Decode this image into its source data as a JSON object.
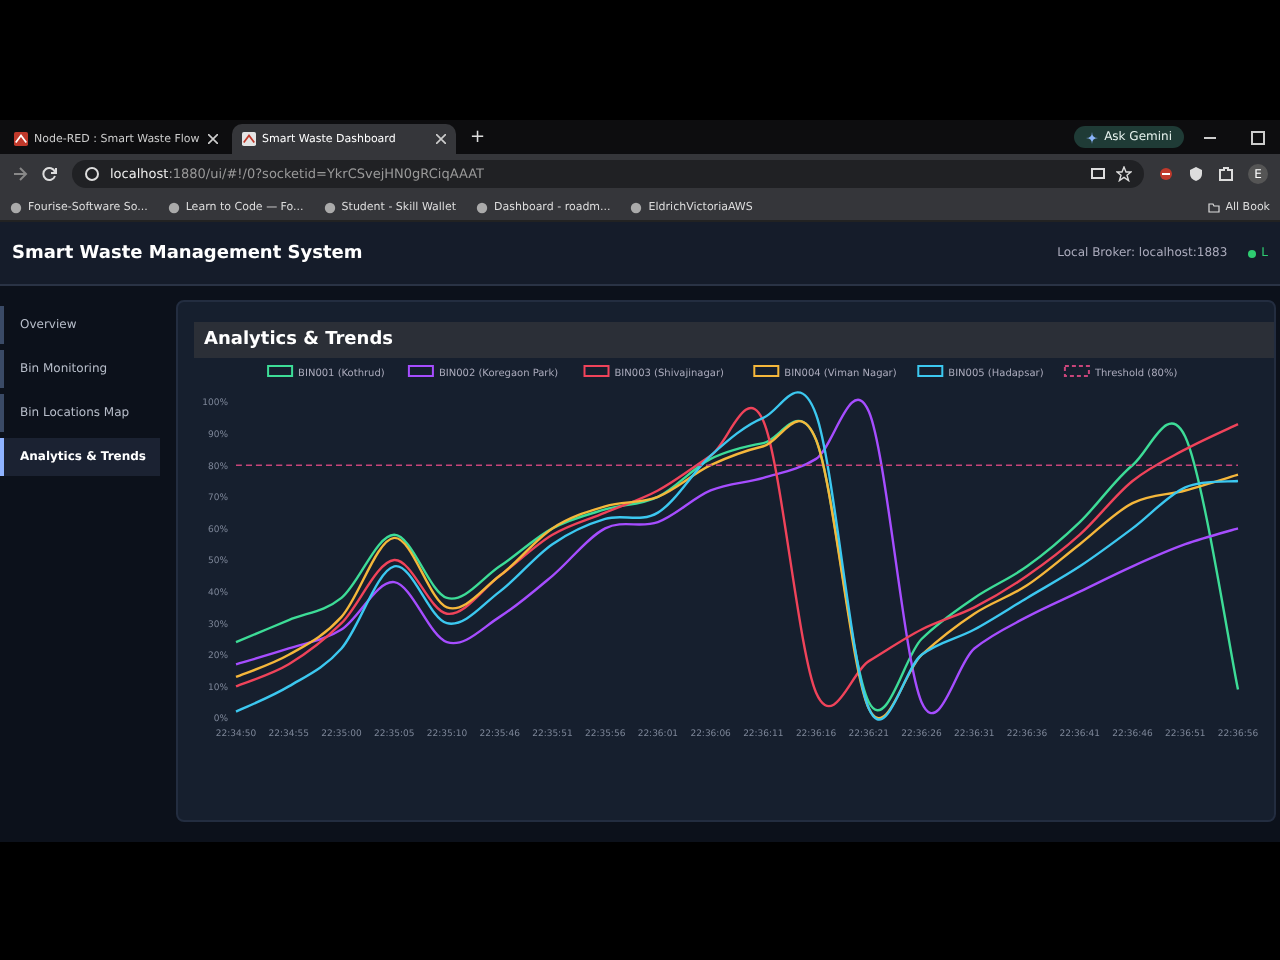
{
  "browser": {
    "tabs": [
      {
        "title": "Node-RED : Smart Waste Flow",
        "selected": false
      },
      {
        "title": "Smart Waste Dashboard",
        "selected": true
      }
    ],
    "new_tab": "+",
    "ask_button": "Ask Gemini",
    "address": {
      "host": "localhost",
      "path": ":1880/ui/#!/0?socketid=YkrCSvejHN0gRCiqAAAT"
    },
    "profile": "E",
    "bookmarks": [
      "Fourise-Software So...",
      "Learn to Code — Fo...",
      "Student - Skill Wallet",
      "Dashboard - roadm...",
      "EldrichVictoriaAWS"
    ],
    "all_bookmarks": "All Book"
  },
  "app": {
    "title": "Smart Waste Management System",
    "broker": "Local Broker: localhost:1883",
    "status_text": "L"
  },
  "sidebar": {
    "items": [
      {
        "label": "Overview",
        "selected": false
      },
      {
        "label": "Bin Monitoring",
        "selected": false
      },
      {
        "label": "Bin Locations Map",
        "selected": false
      },
      {
        "label": "Analytics & Trends",
        "selected": true
      }
    ]
  },
  "panel": {
    "title": "Analytics & Trends",
    "chart_data": {
      "type": "line",
      "categories": [
        "22:34:50",
        "22:34:55",
        "22:35:00",
        "22:35:05",
        "22:35:10",
        "22:35:46",
        "22:35:51",
        "22:35:56",
        "22:36:01",
        "22:36:06",
        "22:36:11",
        "22:36:16",
        "22:36:21",
        "22:36:26",
        "22:36:31",
        "22:36:36",
        "22:36:41",
        "22:36:46",
        "22:36:51",
        "22:36:56"
      ],
      "legend": true,
      "ylim": [
        0,
        100
      ],
      "yticks": [
        {
          "value": 0,
          "label": "0%"
        },
        {
          "value": 10,
          "label": "10%"
        },
        {
          "value": 20,
          "label": "20%"
        },
        {
          "value": 30,
          "label": "30%"
        },
        {
          "value": 40,
          "label": "40%"
        },
        {
          "value": 50,
          "label": "50%"
        },
        {
          "value": 60,
          "label": "60%"
        },
        {
          "value": 70,
          "label": "70%"
        },
        {
          "value": 80,
          "label": "80%"
        },
        {
          "value": 90,
          "label": "90%"
        },
        {
          "value": 100,
          "label": "100%"
        }
      ],
      "series": [
        {
          "name": "BIN001 (Kothrud)",
          "color": "#3ddc97",
          "line_style": "solid",
          "values": [
            24,
            31,
            38,
            58,
            38,
            48,
            60,
            66,
            70,
            82,
            87,
            88,
            5,
            25,
            38,
            48,
            62,
            80,
            89,
            9
          ]
        },
        {
          "name": "BIN002 (Koregaon Park)",
          "color": "#a64dff",
          "line_style": "solid",
          "values": [
            17,
            22,
            28,
            43,
            24,
            32,
            45,
            60,
            62,
            72,
            76,
            82,
            97,
            5,
            22,
            32,
            40,
            48,
            55,
            60
          ]
        },
        {
          "name": "BIN003 (Shivajinagar)",
          "color": "#f0435a",
          "line_style": "solid",
          "values": [
            10,
            17,
            30,
            50,
            33,
            45,
            58,
            65,
            72,
            83,
            94,
            8,
            18,
            28,
            35,
            45,
            58,
            75,
            85,
            93
          ]
        },
        {
          "name": "BIN004 (Viman Nagar)",
          "color": "#f5b73b",
          "line_style": "solid",
          "values": [
            13,
            20,
            32,
            57,
            35,
            45,
            60,
            67,
            70,
            80,
            86,
            88,
            3,
            20,
            33,
            42,
            55,
            68,
            72,
            77
          ]
        },
        {
          "name": "BIN005 (Hadapsar)",
          "color": "#3cc8f0",
          "line_style": "solid",
          "values": [
            2,
            10,
            22,
            48,
            30,
            40,
            55,
            63,
            65,
            83,
            95,
            96,
            3,
            20,
            28,
            38,
            48,
            60,
            73,
            75
          ]
        },
        {
          "name": "Threshold (80%)",
          "color": "#c9457a",
          "line_style": "dashed",
          "values": [
            80,
            80,
            80,
            80,
            80,
            80,
            80,
            80,
            80,
            80,
            80,
            80,
            80,
            80,
            80,
            80,
            80,
            80,
            80,
            80
          ]
        }
      ]
    }
  }
}
